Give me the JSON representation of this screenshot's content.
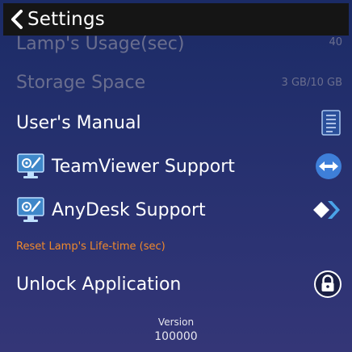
{
  "header": {
    "title": "Settings",
    "back_icon": "chevron-left-icon"
  },
  "rows": {
    "lamp_usage": {
      "label": "Lamp's Usage(sec)",
      "value": "40"
    },
    "storage": {
      "label": "Storage Space",
      "value": "3 GB/10 GB"
    },
    "manual": {
      "label": "User's Manual",
      "icon": "document-icon"
    },
    "teamviewer": {
      "label": "TeamViewer Support",
      "icon": "teamviewer-logo-icon",
      "left_icon": "monitor-settings-icon"
    },
    "anydesk": {
      "label": "AnyDesk Support",
      "icon": "anydesk-logo-icon",
      "left_icon": "monitor-settings-icon"
    },
    "reset": {
      "label": "Reset Lamp's Life-time (sec)"
    },
    "unlock": {
      "label": "Unlock Application",
      "icon": "lock-icon"
    }
  },
  "version": {
    "label": "Version",
    "number": "100000"
  },
  "colors": {
    "header_bg": "#151515",
    "accent_orange": "#f0892c",
    "dim_text": "#6a6e8e",
    "teamviewer_blue": "#3e7fd9",
    "anydesk_blue": "#4aa3e8"
  }
}
